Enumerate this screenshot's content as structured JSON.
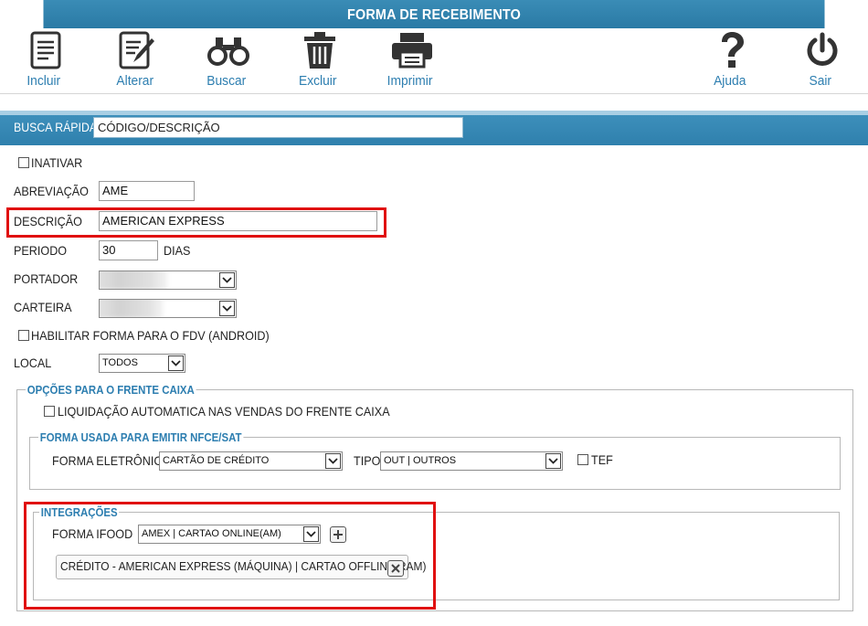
{
  "window": {
    "title": "FORMA DE RECEBIMENTO"
  },
  "toolbar": {
    "incluir": "Incluir",
    "alterar": "Alterar",
    "buscar": "Buscar",
    "excluir": "Excluir",
    "imprimir": "Imprimir",
    "ajuda": "Ajuda",
    "sair": "Sair"
  },
  "busca": {
    "label": "BUSCA RÁPIDA",
    "value": "CÓDIGO/DESCRIÇÃO"
  },
  "form": {
    "inativar": "INATIVAR",
    "abreviacao_label": "ABREVIAÇÃO",
    "abreviacao_value": "AME",
    "descricao_label": "DESCRIÇÃO",
    "descricao_value": "AMERICAN EXPRESS",
    "periodo_label": "PERIODO",
    "periodo_value": "30",
    "periodo_unit": "DIAS",
    "portador_label": "PORTADOR",
    "carteira_label": "CARTEIRA",
    "habilitar_fdv": "HABILITAR FORMA PARA O FDV (ANDROID)",
    "local_label": "LOCAL",
    "local_value": "TODOS"
  },
  "frente_caixa": {
    "legend": "OPÇÕES PARA O FRENTE CAIXA",
    "liquidacao": "LIQUIDAÇÃO AUTOMATICA NAS VENDAS DO FRENTE CAIXA",
    "nfce": {
      "legend": "FORMA USADA PARA EMITIR NFCE/SAT",
      "forma_label": "FORMA ELETRÔNICA",
      "forma_value": "CARTÃO DE CRÉDITO",
      "tipo_label": "TIPO",
      "tipo_value": "OUT | OUTROS",
      "tef": "TEF"
    }
  },
  "integracoes": {
    "legend": "INTEGRAÇÕES",
    "ifood_label": "FORMA IFOOD",
    "ifood_value": "AMEX | CARTAO ONLINE(AM)",
    "tag": "CRÉDITO - AMERICAN EXPRESS (MÁQUINA) | CARTAO OFFLINE(RAM)"
  },
  "colors": {
    "accent": "#2d7eb0",
    "header": "#2f80ad",
    "highlight": "#e01010"
  }
}
